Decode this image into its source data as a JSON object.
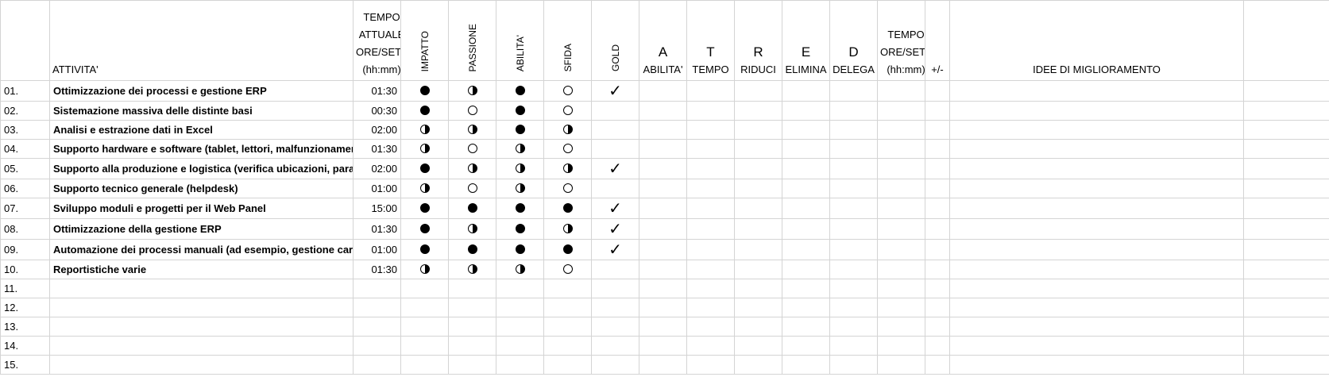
{
  "headers": {
    "attivita": "ATTIVITA'",
    "tempo_attuale": [
      "TEMPO",
      "ATTUALE",
      "ORE/SETT",
      "(hh:mm)"
    ],
    "impatto": "IMPATTO",
    "passione": "PASSIONE",
    "abilita": "ABILITA'",
    "sfida": "SFIDA",
    "gold": "GOLD",
    "a_letter": "A",
    "a_label": "ABILITA'",
    "t_letter": "T",
    "t_label": "TEMPO",
    "r_letter": "R",
    "r_label": "RIDUCI",
    "e_letter": "E",
    "e_label": "ELIMINA",
    "d_letter": "D",
    "d_label": "DELEGA",
    "tempo_nuovo": [
      "TEMPO",
      "ORE/SETT",
      "(hh:mm)"
    ],
    "diff": "+/-",
    "idee": "IDEE DI MIGLIORAMENTO"
  },
  "rows": [
    {
      "num": "01.",
      "activity": "Ottimizzazione dei processi e gestione ERP",
      "time": "01:30",
      "impatto": "full",
      "passione": "half",
      "abilita": "full",
      "sfida": "empty",
      "gold": "✓"
    },
    {
      "num": "02.",
      "activity": "Sistemazione massiva delle distinte basi",
      "time": "00:30",
      "impatto": "full",
      "passione": "empty",
      "abilita": "full",
      "sfida": "empty",
      "gold": ""
    },
    {
      "num": "03.",
      "activity": "Analisi e estrazione dati in Excel",
      "time": "02:00",
      "impatto": "half",
      "passione": "half",
      "abilita": "full",
      "sfida": "half",
      "gold": ""
    },
    {
      "num": "04.",
      "activity": "Supporto hardware e software (tablet, lettori, malfunzionamenti)",
      "time": "01:30",
      "impatto": "half",
      "passione": "empty",
      "abilita": "half",
      "sfida": "empty",
      "gold": ""
    },
    {
      "num": "05.",
      "activity": "Supporto alla produzione e logistica (verifica ubicazioni, parametri",
      "time": "02:00",
      "impatto": "full",
      "passione": "half",
      "abilita": "half",
      "sfida": "half",
      "gold": "✓"
    },
    {
      "num": "06.",
      "activity": "Supporto tecnico generale (helpdesk)",
      "time": "01:00",
      "impatto": "half",
      "passione": "empty",
      "abilita": "half",
      "sfida": "empty",
      "gold": ""
    },
    {
      "num": "07.",
      "activity": "Sviluppo moduli e progetti per il Web Panel",
      "time": "15:00",
      "impatto": "full",
      "passione": "full",
      "abilita": "full",
      "sfida": "full",
      "gold": "✓"
    },
    {
      "num": "08.",
      "activity": "Ottimizzazione della gestione ERP",
      "time": "01:30",
      "impatto": "full",
      "passione": "half",
      "abilita": "full",
      "sfida": "half",
      "gold": "✓"
    },
    {
      "num": "09.",
      "activity": "Automazione dei processi manuali (ad esempio, gestione carichi)",
      "time": "01:00",
      "impatto": "full",
      "passione": "full",
      "abilita": "full",
      "sfida": "full",
      "gold": "✓"
    },
    {
      "num": "10.",
      "activity": "Reportistiche varie",
      "time": "01:30",
      "impatto": "half",
      "passione": "half",
      "abilita": "half",
      "sfida": "empty",
      "gold": ""
    },
    {
      "num": "11.",
      "activity": "",
      "time": "",
      "impatto": "",
      "passione": "",
      "abilita": "",
      "sfida": "",
      "gold": ""
    },
    {
      "num": "12.",
      "activity": "",
      "time": "",
      "impatto": "",
      "passione": "",
      "abilita": "",
      "sfida": "",
      "gold": ""
    },
    {
      "num": "13.",
      "activity": "",
      "time": "",
      "impatto": "",
      "passione": "",
      "abilita": "",
      "sfida": "",
      "gold": ""
    },
    {
      "num": "14.",
      "activity": "",
      "time": "",
      "impatto": "",
      "passione": "",
      "abilita": "",
      "sfida": "",
      "gold": ""
    },
    {
      "num": "15.",
      "activity": "",
      "time": "",
      "impatto": "",
      "passione": "",
      "abilita": "",
      "sfida": "",
      "gold": ""
    }
  ]
}
